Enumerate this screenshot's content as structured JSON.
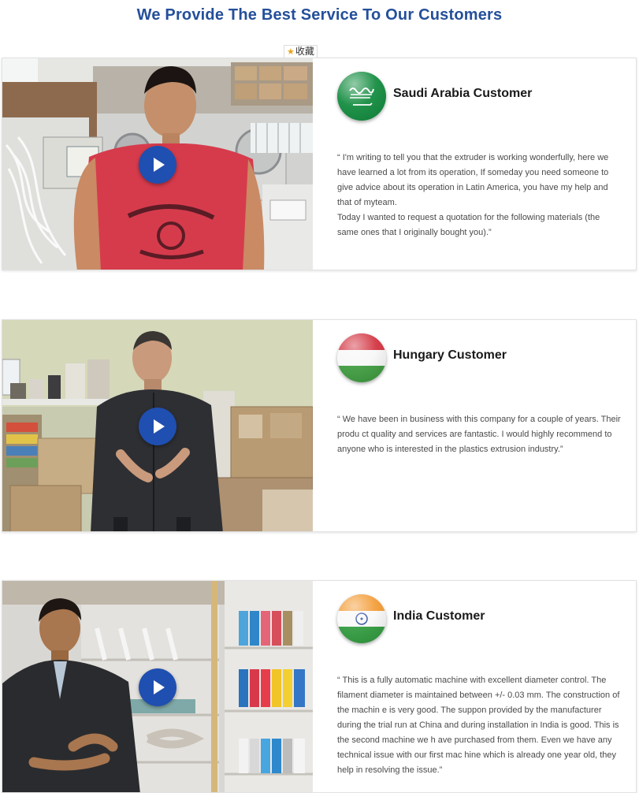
{
  "page": {
    "title": "We Provide The Best Service To Our Customers",
    "favorite_label": "收藏"
  },
  "colors": {
    "title": "#244f9a",
    "play_button": "#1f4fb0",
    "text": "#4a4a4a"
  },
  "testimonials": [
    {
      "customer": "Saudi Arabia Customer",
      "flag_icon": "saudi-arabia-flag-icon",
      "quote": "“ I'm writing to tell you that the extruder is working wonderfully, here we have learned a lot from its operation, If someday you need someone to give advice about its operation in Latin America, you have my help and that of myteam.\nToday I wanted to request a quotation for the following materials (the same ones that I originally bought you).”"
    },
    {
      "customer": "Hungary Customer",
      "flag_icon": "hungary-flag-icon",
      "quote": "“ We have been in business with this company for a couple of years. Their produ ct quality and services are fantastic. I would highly recommend to anyone who is interested in the plastics extrusion industry.”"
    },
    {
      "customer": "India Customer",
      "flag_icon": "india-flag-icon",
      "quote": "“ This is a fully automatic machine with excellent diameter control. The filament diameter is maintained between +/- 0.03 mm. The construction of the machin e is very good. The suppon provided by the manufacturer during the trial run at China and during installation in India is good. This is the second machine we h ave purchased from them. Even we have any technical issue with our first mac hine which is already one year old, they help in resolving the issue.”"
    }
  ]
}
